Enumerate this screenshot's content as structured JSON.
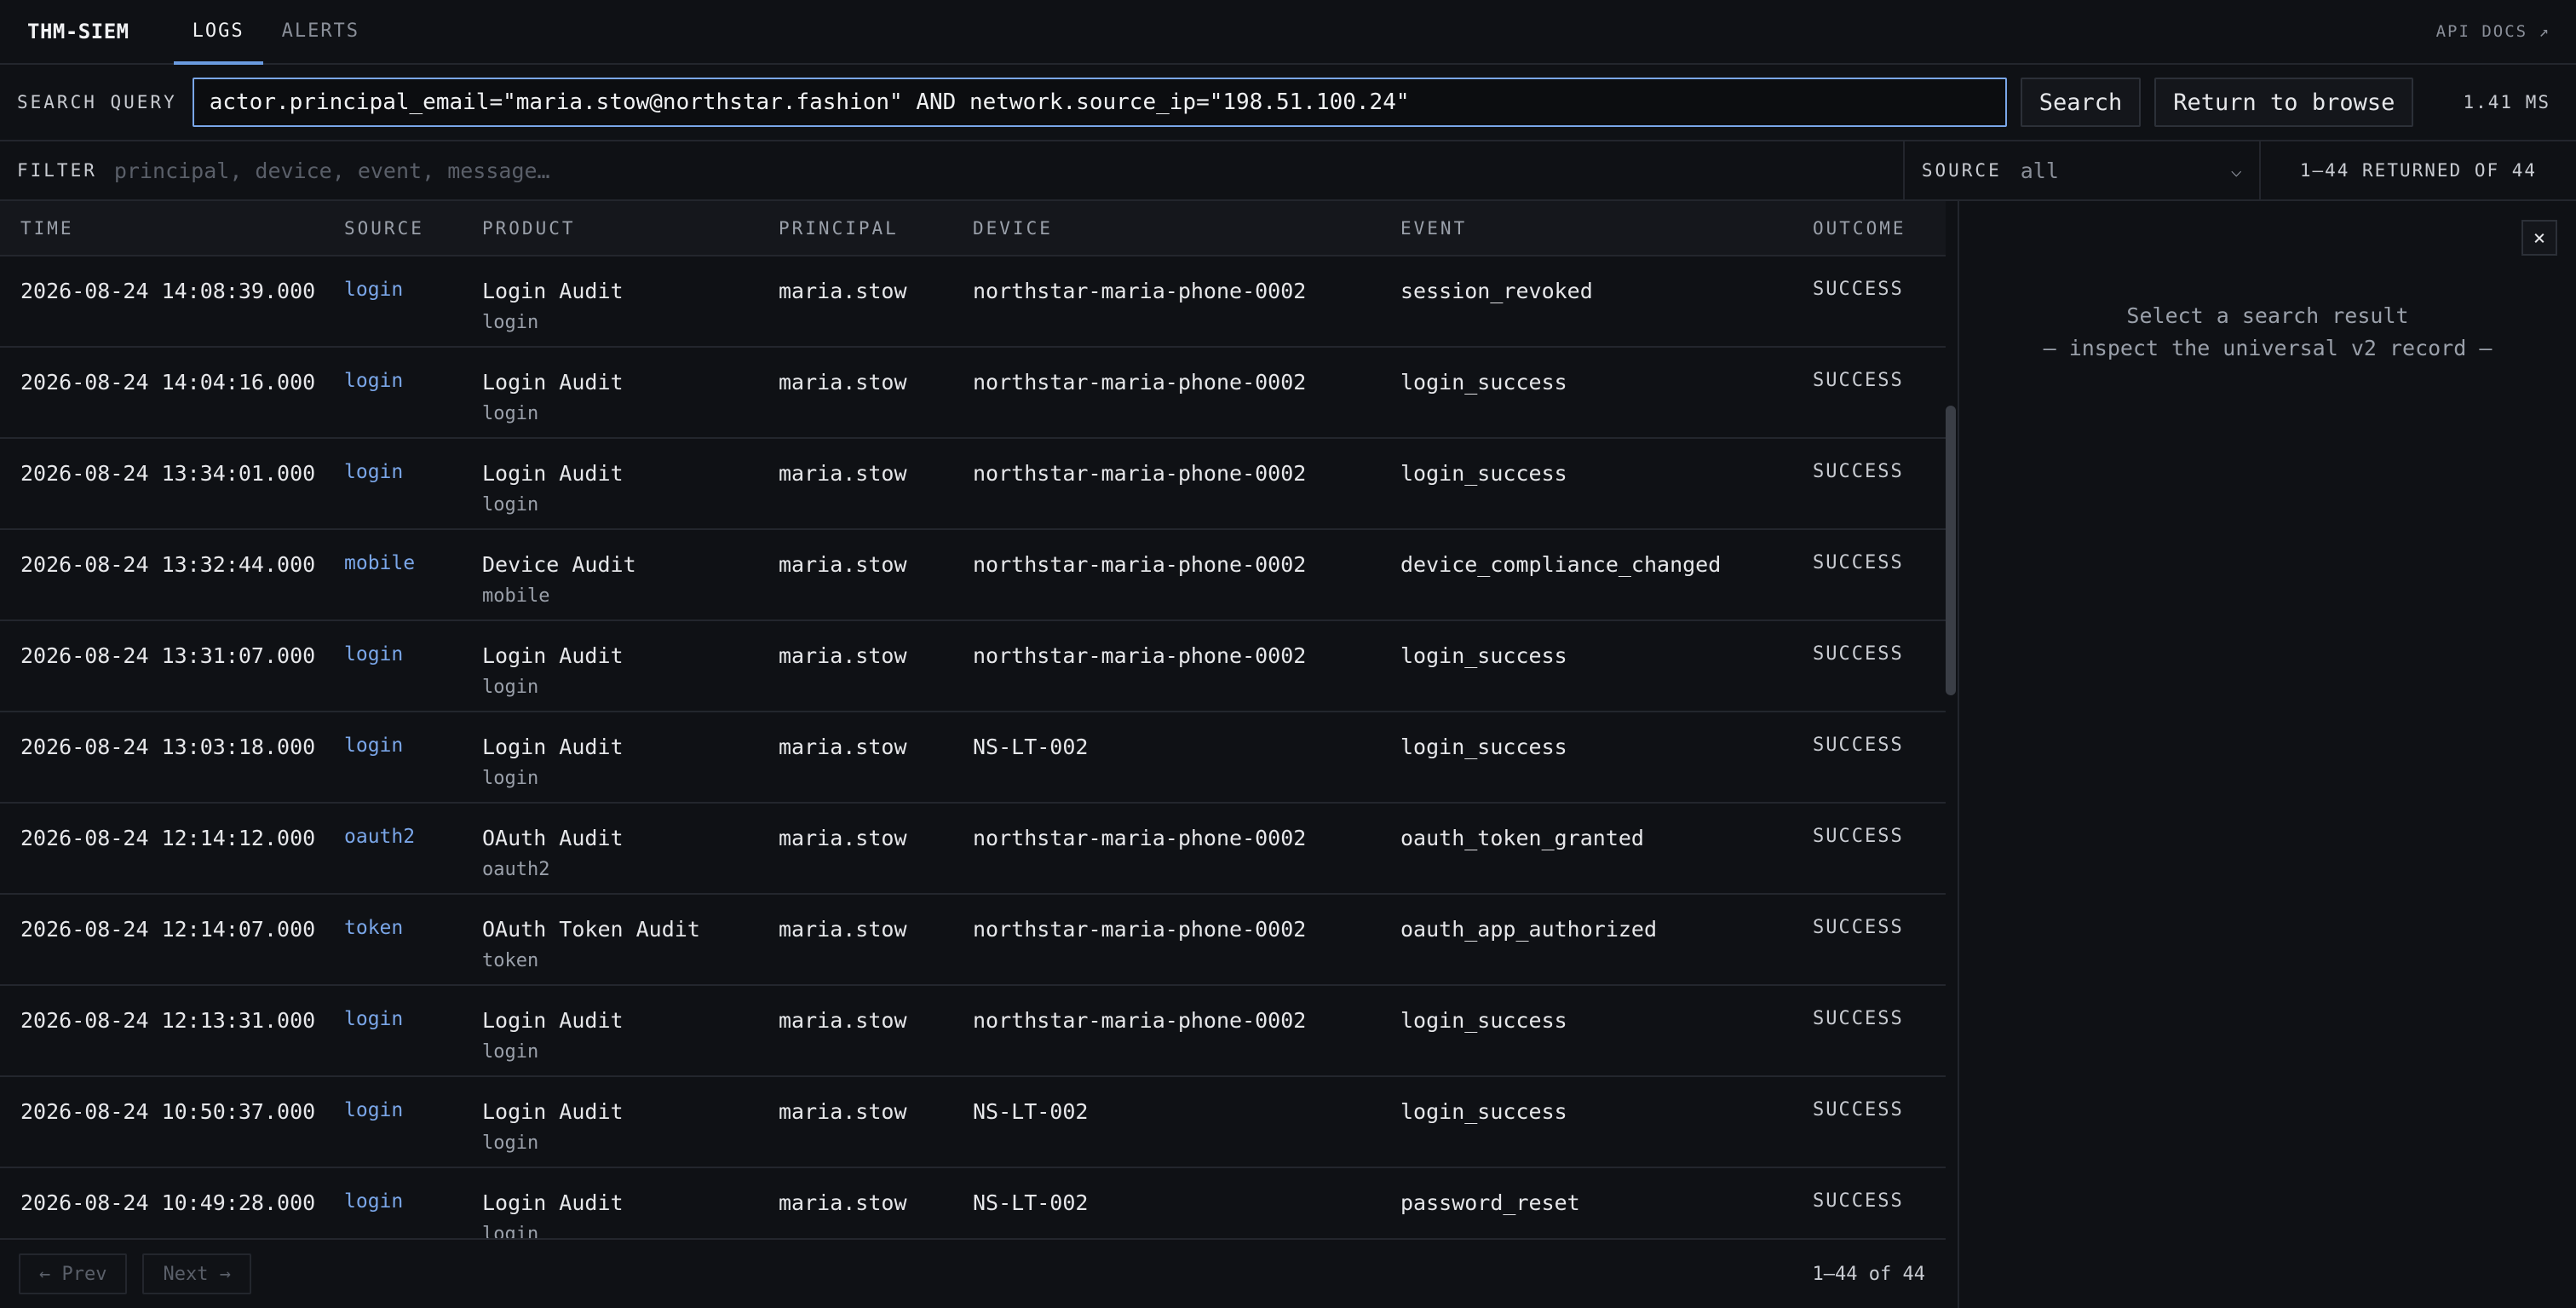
{
  "nav": {
    "brand": "THM-SIEM",
    "tabs": [
      {
        "label": "LOGS"
      },
      {
        "label": "ALERTS"
      }
    ],
    "api_docs": "API DOCS ↗"
  },
  "search": {
    "label": "SEARCH QUERY",
    "value": "actor.principal_email=\"maria.stow@northstar.fashion\" AND network.source_ip=\"198.51.100.24\"",
    "search_button": "Search",
    "return_button": "Return to browse",
    "timing": "1.41 MS"
  },
  "filter": {
    "label": "FILTER",
    "placeholder": "principal, device, event, message…",
    "source_label": "SOURCE",
    "source_value": "all",
    "returned": "1–44 RETURNED OF 44"
  },
  "table": {
    "headers": [
      "TIME",
      "SOURCE",
      "PRODUCT",
      "PRINCIPAL",
      "DEVICE",
      "EVENT",
      "OUTCOME"
    ],
    "rows": [
      {
        "time": "2026-08-24 14:08:39.000",
        "source": "login",
        "product": "Login Audit",
        "product_sub": "login",
        "principal": "maria.stow",
        "device": "northstar-maria-phone-0002",
        "event": "session_revoked",
        "outcome": "SUCCESS"
      },
      {
        "time": "2026-08-24 14:04:16.000",
        "source": "login",
        "product": "Login Audit",
        "product_sub": "login",
        "principal": "maria.stow",
        "device": "northstar-maria-phone-0002",
        "event": "login_success",
        "outcome": "SUCCESS"
      },
      {
        "time": "2026-08-24 13:34:01.000",
        "source": "login",
        "product": "Login Audit",
        "product_sub": "login",
        "principal": "maria.stow",
        "device": "northstar-maria-phone-0002",
        "event": "login_success",
        "outcome": "SUCCESS"
      },
      {
        "time": "2026-08-24 13:32:44.000",
        "source": "mobile",
        "product": "Device Audit",
        "product_sub": "mobile",
        "principal": "maria.stow",
        "device": "northstar-maria-phone-0002",
        "event": "device_compliance_changed",
        "outcome": "SUCCESS"
      },
      {
        "time": "2026-08-24 13:31:07.000",
        "source": "login",
        "product": "Login Audit",
        "product_sub": "login",
        "principal": "maria.stow",
        "device": "northstar-maria-phone-0002",
        "event": "login_success",
        "outcome": "SUCCESS"
      },
      {
        "time": "2026-08-24 13:03:18.000",
        "source": "login",
        "product": "Login Audit",
        "product_sub": "login",
        "principal": "maria.stow",
        "device": "NS-LT-002",
        "event": "login_success",
        "outcome": "SUCCESS"
      },
      {
        "time": "2026-08-24 12:14:12.000",
        "source": "oauth2",
        "product": "OAuth Audit",
        "product_sub": "oauth2",
        "principal": "maria.stow",
        "device": "northstar-maria-phone-0002",
        "event": "oauth_token_granted",
        "outcome": "SUCCESS"
      },
      {
        "time": "2026-08-24 12:14:07.000",
        "source": "token",
        "product": "OAuth Token Audit",
        "product_sub": "token",
        "principal": "maria.stow",
        "device": "northstar-maria-phone-0002",
        "event": "oauth_app_authorized",
        "outcome": "SUCCESS"
      },
      {
        "time": "2026-08-24 12:13:31.000",
        "source": "login",
        "product": "Login Audit",
        "product_sub": "login",
        "principal": "maria.stow",
        "device": "northstar-maria-phone-0002",
        "event": "login_success",
        "outcome": "SUCCESS"
      },
      {
        "time": "2026-08-24 10:50:37.000",
        "source": "login",
        "product": "Login Audit",
        "product_sub": "login",
        "principal": "maria.stow",
        "device": "NS-LT-002",
        "event": "login_success",
        "outcome": "SUCCESS"
      },
      {
        "time": "2026-08-24 10:49:28.000",
        "source": "login",
        "product": "Login Audit",
        "product_sub": "login",
        "principal": "maria.stow",
        "device": "NS-LT-002",
        "event": "password_reset",
        "outcome": "SUCCESS"
      }
    ]
  },
  "pager": {
    "prev": "← Prev",
    "next": "Next →",
    "count": "1–44 of 44"
  },
  "detail": {
    "close": "×",
    "empty_line1": "Select a search result",
    "empty_line2": "— inspect the universal v2 record —"
  }
}
